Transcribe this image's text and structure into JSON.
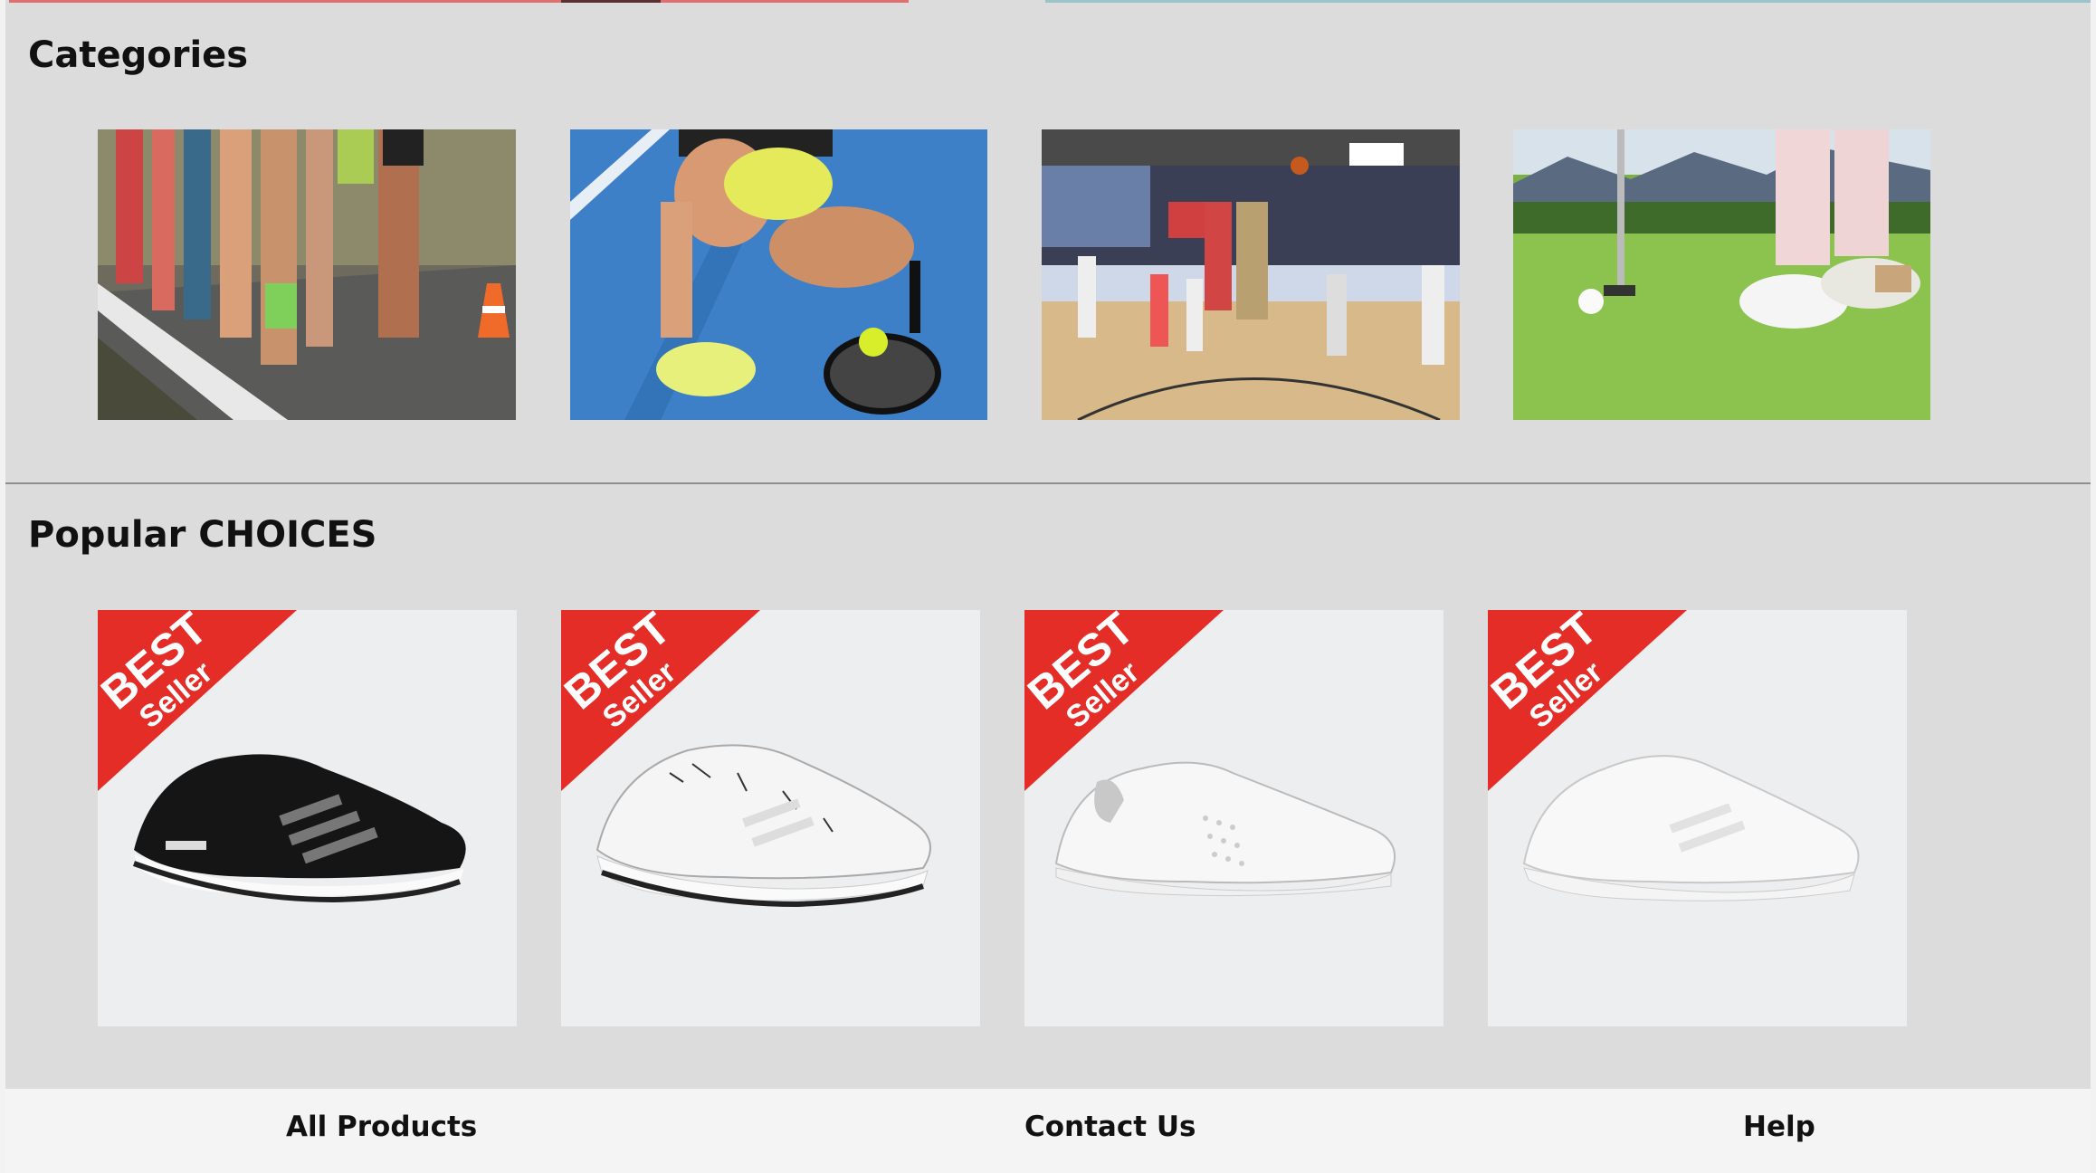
{
  "categories": {
    "title": "Categories",
    "items": [
      {
        "image": "running-race-photo"
      },
      {
        "image": "tennis-player-tying-shoe-photo"
      },
      {
        "image": "basketball-game-photo"
      },
      {
        "image": "golf-putting-photo"
      }
    ]
  },
  "popular": {
    "title": "Popular CHOICES",
    "badge": {
      "line1": "BEST",
      "line2": "Seller",
      "color": "#e52d27"
    },
    "items": [
      {
        "shoe": "black-running-shoe"
      },
      {
        "shoe": "white-patterned-running-shoe"
      },
      {
        "shoe": "white-court-sneaker"
      },
      {
        "shoe": "white-knit-running-shoe"
      }
    ]
  },
  "footer": {
    "links": [
      "All Products",
      "Contact Us",
      "Help"
    ]
  }
}
